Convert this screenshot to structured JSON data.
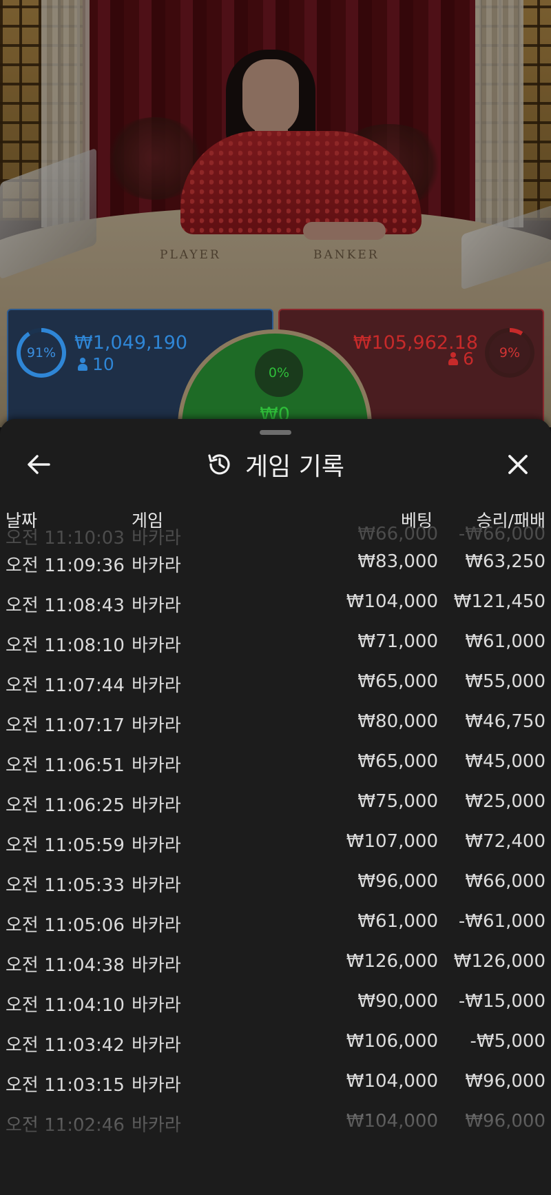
{
  "table": {
    "player_label": "PLAYER",
    "banker_label": "BANKER"
  },
  "bets": {
    "player": {
      "percent": "91%",
      "amount": "₩1,049,190",
      "players": "10",
      "color": "#2f86d6"
    },
    "banker": {
      "percent": "9%",
      "amount": "₩105,962.18",
      "players": "6",
      "color": "#c72a2a"
    },
    "tie": {
      "percent": "0%",
      "amount": "₩0",
      "color": "#2fbf3a"
    }
  },
  "history": {
    "title": "게임 기록",
    "icons": {
      "back": "arrow-left-icon",
      "history": "history-clock-icon",
      "close": "close-icon"
    },
    "columns": {
      "date": "날짜",
      "game": "게임",
      "bet": "베팅",
      "result": "승리/패배"
    },
    "rows": [
      {
        "date": "오전 11:10:03",
        "game": "바카라",
        "bet": "₩66,000",
        "result": "-₩66,000"
      },
      {
        "date": "오전 11:09:36",
        "game": "바카라",
        "bet": "₩83,000",
        "result": "₩63,250"
      },
      {
        "date": "오전 11:08:43",
        "game": "바카라",
        "bet": "₩104,000",
        "result": "₩121,450"
      },
      {
        "date": "오전 11:08:10",
        "game": "바카라",
        "bet": "₩71,000",
        "result": "₩61,000"
      },
      {
        "date": "오전 11:07:44",
        "game": "바카라",
        "bet": "₩65,000",
        "result": "₩55,000"
      },
      {
        "date": "오전 11:07:17",
        "game": "바카라",
        "bet": "₩80,000",
        "result": "₩46,750"
      },
      {
        "date": "오전 11:06:51",
        "game": "바카라",
        "bet": "₩65,000",
        "result": "₩45,000"
      },
      {
        "date": "오전 11:06:25",
        "game": "바카라",
        "bet": "₩75,000",
        "result": "₩25,000"
      },
      {
        "date": "오전 11:05:59",
        "game": "바카라",
        "bet": "₩107,000",
        "result": "₩72,400"
      },
      {
        "date": "오전 11:05:33",
        "game": "바카라",
        "bet": "₩96,000",
        "result": "₩66,000"
      },
      {
        "date": "오전 11:05:06",
        "game": "바카라",
        "bet": "₩61,000",
        "result": "-₩61,000"
      },
      {
        "date": "오전 11:04:38",
        "game": "바카라",
        "bet": "₩126,000",
        "result": "₩126,000"
      },
      {
        "date": "오전 11:04:10",
        "game": "바카라",
        "bet": "₩90,000",
        "result": "-₩15,000"
      },
      {
        "date": "오전 11:03:42",
        "game": "바카라",
        "bet": "₩106,000",
        "result": "-₩5,000"
      },
      {
        "date": "오전 11:03:15",
        "game": "바카라",
        "bet": "₩104,000",
        "result": "₩96,000"
      },
      {
        "date": "오전 11:02:46",
        "game": "바카라",
        "bet": "₩104,000",
        "result": "₩96,000"
      }
    ]
  }
}
